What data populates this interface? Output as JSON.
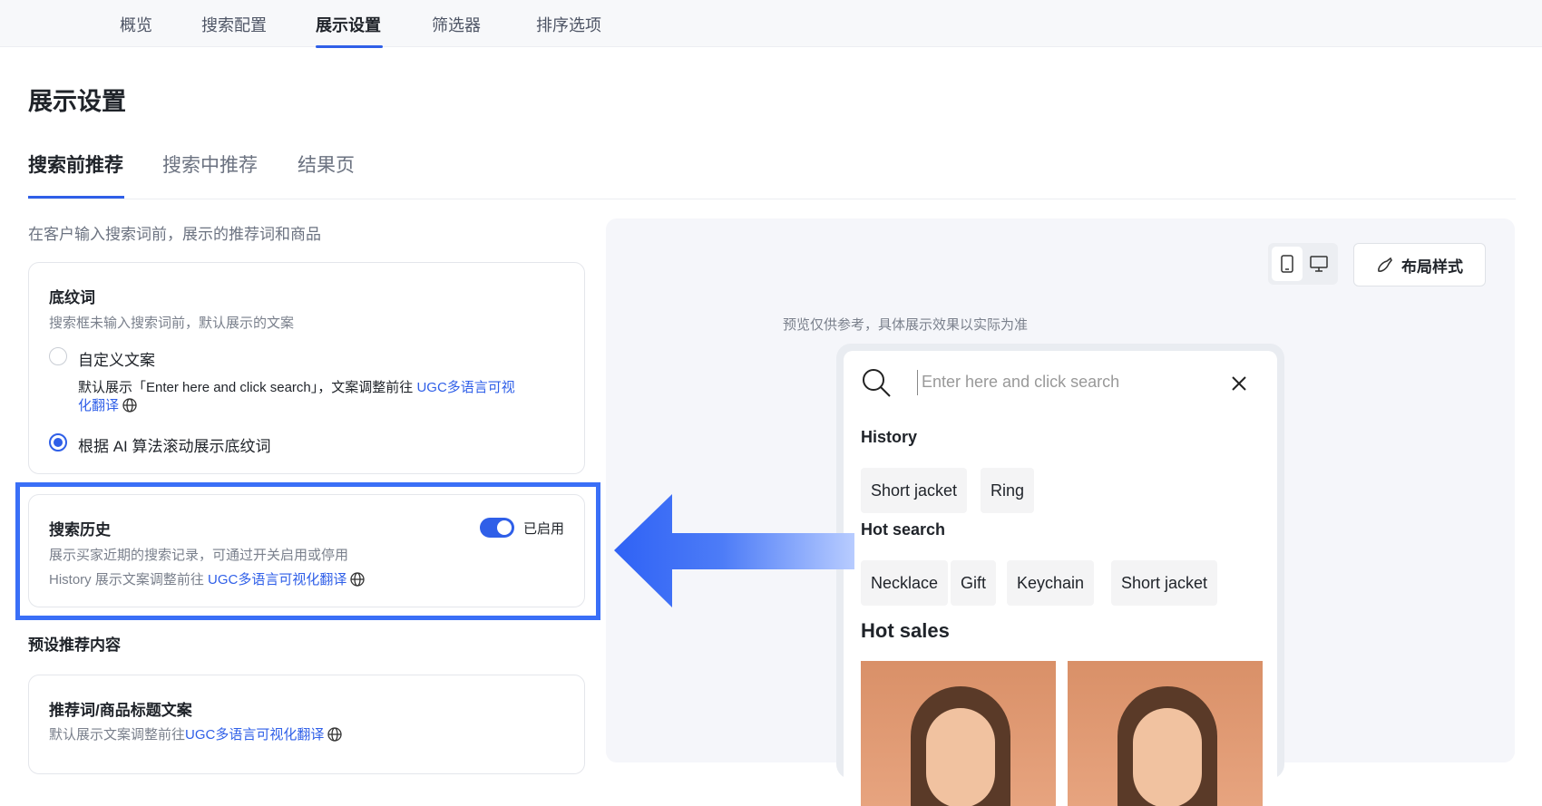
{
  "topnav": {
    "tabs": [
      "概览",
      "搜索配置",
      "展示设置",
      "筛选器",
      "排序选项"
    ],
    "active": "展示设置"
  },
  "page_title": "展示设置",
  "subtabs": [
    "搜索前推荐",
    "搜索中推荐",
    "结果页"
  ],
  "section_desc": "在客户输入搜索词前，展示的推荐词和商品",
  "placeholder_card": {
    "title": "底纹词",
    "desc": "搜索框未输入搜索词前，默认展示的文案",
    "option_custom": "自定义文案",
    "custom_hint": "默认展示「Enter here and click search」，文案调整前往 ",
    "custom_link_1": "UGC多语言可视",
    "custom_link_2": "化翻译",
    "option_ai": "根据 AI 算法滚动展示底纹词",
    "selected": "ai"
  },
  "history_card": {
    "title": "搜索历史",
    "toggle_label": "已启用",
    "enabled": true,
    "desc": "展示买家近期的搜索记录，可通过开关启用或停用",
    "hint": "History 展示文案调整前往 ",
    "link": "UGC多语言可视化翻译"
  },
  "preset_heading": "预设推荐内容",
  "preset_card": {
    "title": "推荐词/商品标题文案",
    "hint": "默认展示文案调整前往",
    "link": "UGC多语言可视化翻译"
  },
  "preview": {
    "layout_button": "布局样式",
    "note": "预览仅供参考，具体展示效果以实际为准",
    "search_placeholder": "Enter here and click search",
    "history_title": "History",
    "history_chips": [
      "Short jacket",
      "Ring"
    ],
    "hot_search_title": "Hot search",
    "hot_chips": [
      "Necklace",
      "Gift",
      "Keychain",
      "Short jacket"
    ],
    "hot_sales_title": "Hot sales"
  },
  "colors": {
    "accent": "#2f5fe8",
    "highlight": "#3a6ff7"
  }
}
